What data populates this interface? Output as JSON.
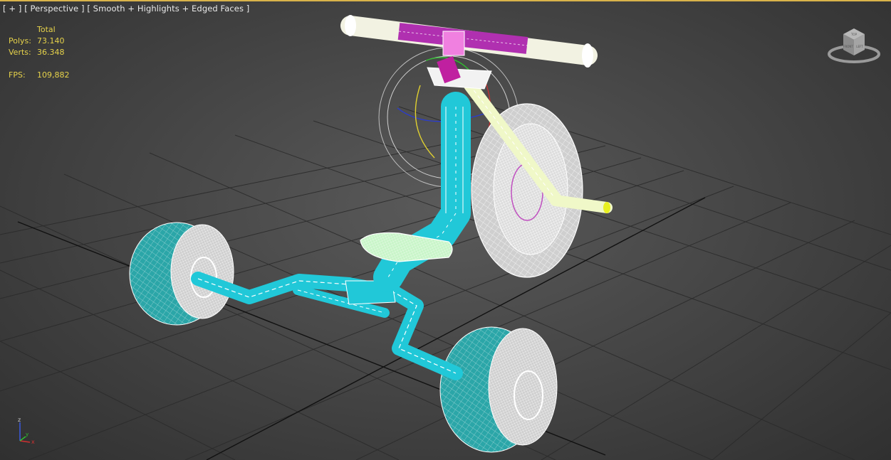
{
  "viewport": {
    "label_plus": "[ + ]",
    "label_view": "[ Perspective ]",
    "label_shading": "[ Smooth + Highlights + Edged Faces ]"
  },
  "stats": {
    "header": "Total",
    "polys_label": "Polys:",
    "polys_value": "73.140",
    "verts_label": "Verts:",
    "verts_value": "36.348",
    "fps_label": "FPS:",
    "fps_value": "109,882"
  },
  "colors": {
    "viewport_border": "#d9b34a",
    "stats_text": "#e6d24a",
    "grid": "#2a2a2a",
    "frame": "#21c8d8",
    "wheel_tire": "#2ba6a8",
    "wireframe": "#ffffff",
    "handlebar_pink": "#b030b0"
  },
  "icons": {
    "viewcube": "viewcube-icon",
    "axis": "axis-tripod-icon",
    "gizmo": "rotate-gizmo-icon"
  },
  "viewcube_faces": {
    "top": "TOP",
    "left": "FRONT",
    "right": "LEFT"
  },
  "axis_labels": {
    "z": "z",
    "x": "x",
    "y": "y"
  }
}
